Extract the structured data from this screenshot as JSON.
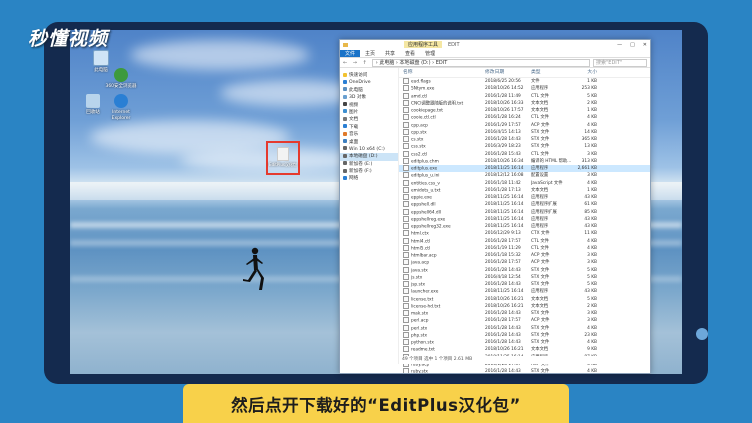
{
  "watermark": "秒懂视频",
  "subtitle": "然后点开下载好的“EditPlus汉化包”",
  "colors": {
    "frame": "#142a4e",
    "outer": "#2a84c4",
    "subtitle_bg": "#f8d14a",
    "selection": "#e53a2e",
    "ribbon_active": "#1a73c8"
  },
  "desktop": {
    "icons": [
      {
        "label": "此电脑",
        "icon": "computer-icon"
      },
      {
        "label": "360安全浏览器",
        "icon": "browser-icon"
      },
      {
        "label": "回收站",
        "icon": "recycle-bin-icon"
      },
      {
        "label": "Internet Explorer",
        "icon": "ie-icon"
      }
    ],
    "selected_file": {
      "label": "EditPlus汉化包",
      "icon": "file-icon"
    }
  },
  "explorer": {
    "title_context": "应用程序工具",
    "title_path": "EDIT",
    "ribbon_tabs": [
      "文件",
      "主页",
      "共享",
      "查看",
      "管理"
    ],
    "address": "› 此电脑 › 本地磁盘 (D:) › EDIT",
    "search_placeholder": "搜索\"EDIT\"",
    "nav": [
      {
        "label": "快速访问",
        "icon": "star-icon"
      },
      {
        "label": "OneDrive",
        "icon": "cloud-icon"
      },
      {
        "label": "此电脑",
        "icon": "computer-icon"
      },
      {
        "label": "3D 对象",
        "icon": "cube-icon"
      },
      {
        "label": "视频",
        "icon": "video-icon"
      },
      {
        "label": "图片",
        "icon": "picture-icon"
      },
      {
        "label": "文档",
        "icon": "document-icon"
      },
      {
        "label": "下载",
        "icon": "download-icon"
      },
      {
        "label": "音乐",
        "icon": "music-icon"
      },
      {
        "label": "桌面",
        "icon": "desktop-icon"
      },
      {
        "label": "Win 10 x64 (C:)",
        "icon": "drive-icon"
      },
      {
        "label": "本地磁盘 (D:)",
        "icon": "drive-icon"
      },
      {
        "label": "新加卷 (E:)",
        "icon": "drive-icon"
      },
      {
        "label": "新加卷 (F:)",
        "icon": "drive-icon"
      },
      {
        "label": "网络",
        "icon": "network-icon"
      }
    ],
    "columns": [
      "名称",
      "修改日期",
      "类型",
      "大小"
    ],
    "files": [
      {
        "name": "eud.flags",
        "date": "2018/6/25 20:56",
        "type": "文件",
        "size": "1 KB"
      },
      {
        "name": "5Ntym.exe",
        "date": "2018/10/26 14:52",
        "type": "应用程序",
        "size": "253 KB"
      },
      {
        "name": "amd.ctl",
        "date": "2016/1/28 11:49",
        "type": "CTL 文件",
        "size": "5 KB"
      },
      {
        "name": "CNCI调整跟随版的说明.txt",
        "date": "2018/10/26 16:33",
        "type": "文本文档",
        "size": "2 KB"
      },
      {
        "name": "cookiepage.txt",
        "date": "2018/10/26 17:57",
        "type": "文本文档",
        "size": "1 KB"
      },
      {
        "name": "cooie.ctl.ctl",
        "date": "2016/1/28 16:24",
        "type": "CTL 文件",
        "size": "4 KB"
      },
      {
        "name": "cpp.acp",
        "date": "2016/1/29 17:57",
        "type": "ACP 文件",
        "size": "4 KB"
      },
      {
        "name": "cpp.stx",
        "date": "2016/4/15 14:13",
        "type": "STX 文件",
        "size": "14 KB"
      },
      {
        "name": "cs.stx",
        "date": "2016/1/28 14:43",
        "type": "STX 文件",
        "size": "365 KB"
      },
      {
        "name": "css.stx",
        "date": "2016/3/29 18:23",
        "type": "STX 文件",
        "size": "13 KB"
      },
      {
        "name": "css2.ctl",
        "date": "2016/1/28 15:43",
        "type": "CTL 文件",
        "size": "3 KB"
      },
      {
        "name": "editplus.chm",
        "date": "2018/10/26 16:34",
        "type": "编译的 HTML 帮助...",
        "size": "313 KB"
      },
      {
        "name": "editplus.exe",
        "date": "2018/11/25 16:14",
        "type": "应用程序",
        "size": "2,661 KB"
      },
      {
        "name": "editplus_u.ini",
        "date": "2018/12/12 16:08",
        "type": "配置设置",
        "size": "3 KB"
      },
      {
        "name": "entities.css_v",
        "date": "2016/1/18 11:42",
        "type": "JavaScript 文件",
        "size": "4 KB"
      },
      {
        "name": "emidots_u.txt",
        "date": "2016/1/28 17:13",
        "type": "文本文档",
        "size": "1 KB"
      },
      {
        "name": "eppie.exe",
        "date": "2018/11/25 16:14",
        "type": "应用程序",
        "size": "43 KB"
      },
      {
        "name": "eppshell.dll",
        "date": "2018/11/25 16:14",
        "type": "应用程序扩展",
        "size": "61 KB"
      },
      {
        "name": "eppshell64.dll",
        "date": "2018/11/25 16:14",
        "type": "应用程序扩展",
        "size": "85 KB"
      },
      {
        "name": "eppshellreg.exe",
        "date": "2018/11/25 16:14",
        "type": "应用程序",
        "size": "43 KB"
      },
      {
        "name": "eppshellreg32.exe",
        "date": "2018/11/25 16:14",
        "type": "应用程序",
        "size": "43 KB"
      },
      {
        "name": "html.ctx",
        "date": "2016/12/29 9:13",
        "type": "CTX 文件",
        "size": "11 KB"
      },
      {
        "name": "html4.ctl",
        "date": "2016/1/28 17:57",
        "type": "CTL 文件",
        "size": "4 KB"
      },
      {
        "name": "html5.ctl",
        "date": "2016/1/19 11:29",
        "type": "CTL 文件",
        "size": "4 KB"
      },
      {
        "name": "htmlbar.acp",
        "date": "2016/1/18 15:32",
        "type": "ACP 文件",
        "size": "3 KB"
      },
      {
        "name": "java.acp",
        "date": "2016/1/28 17:57",
        "type": "ACP 文件",
        "size": "3 KB"
      },
      {
        "name": "java.stx",
        "date": "2016/1/28 14:43",
        "type": "STX 文件",
        "size": "5 KB"
      },
      {
        "name": "js.stx",
        "date": "2016/4/18 12:54",
        "type": "STX 文件",
        "size": "5 KB"
      },
      {
        "name": "jsp.stx",
        "date": "2016/1/28 14:43",
        "type": "STX 文件",
        "size": "5 KB"
      },
      {
        "name": "launcher.exe",
        "date": "2018/11/25 16:14",
        "type": "应用程序",
        "size": "43 KB"
      },
      {
        "name": "license.txt",
        "date": "2018/10/26 16:21",
        "type": "文本文档",
        "size": "5 KB"
      },
      {
        "name": "license-hd.txt",
        "date": "2018/10/26 16:21",
        "type": "文本文档",
        "size": "2 KB"
      },
      {
        "name": "mak.stx",
        "date": "2016/1/28 14:43",
        "type": "STX 文件",
        "size": "3 KB"
      },
      {
        "name": "perl.acp",
        "date": "2016/1/28 17:57",
        "type": "ACP 文件",
        "size": "3 KB"
      },
      {
        "name": "perl.stx",
        "date": "2016/1/28 14:43",
        "type": "STX 文件",
        "size": "4 KB"
      },
      {
        "name": "php.stx",
        "date": "2016/1/28 14:43",
        "type": "STX 文件",
        "size": "23 KB"
      },
      {
        "name": "python.stx",
        "date": "2016/1/28 14:43",
        "type": "STX 文件",
        "size": "4 KB"
      },
      {
        "name": "readme.txt",
        "date": "2018/10/26 16:21",
        "type": "文本文档",
        "size": "9 KB"
      },
      {
        "name": "remove.exe",
        "date": "2018/11/25 16:14",
        "type": "应用程序",
        "size": "87 KB"
      },
      {
        "name": "ruby.acp",
        "date": "2016/1/28 17:57",
        "type": "ACP 文件",
        "size": "3 KB"
      },
      {
        "name": "ruby.stx",
        "date": "2016/1/28 14:43",
        "type": "STX 文件",
        "size": "4 KB"
      },
      {
        "name": "SETUP.CLI",
        "date": "2016/1/28 14:43",
        "type": "CLI 文件",
        "size": "2 KB"
      }
    ],
    "highlighted_index": 12,
    "status": "49 个项目   选中 1 个项目 2.61 MB"
  }
}
